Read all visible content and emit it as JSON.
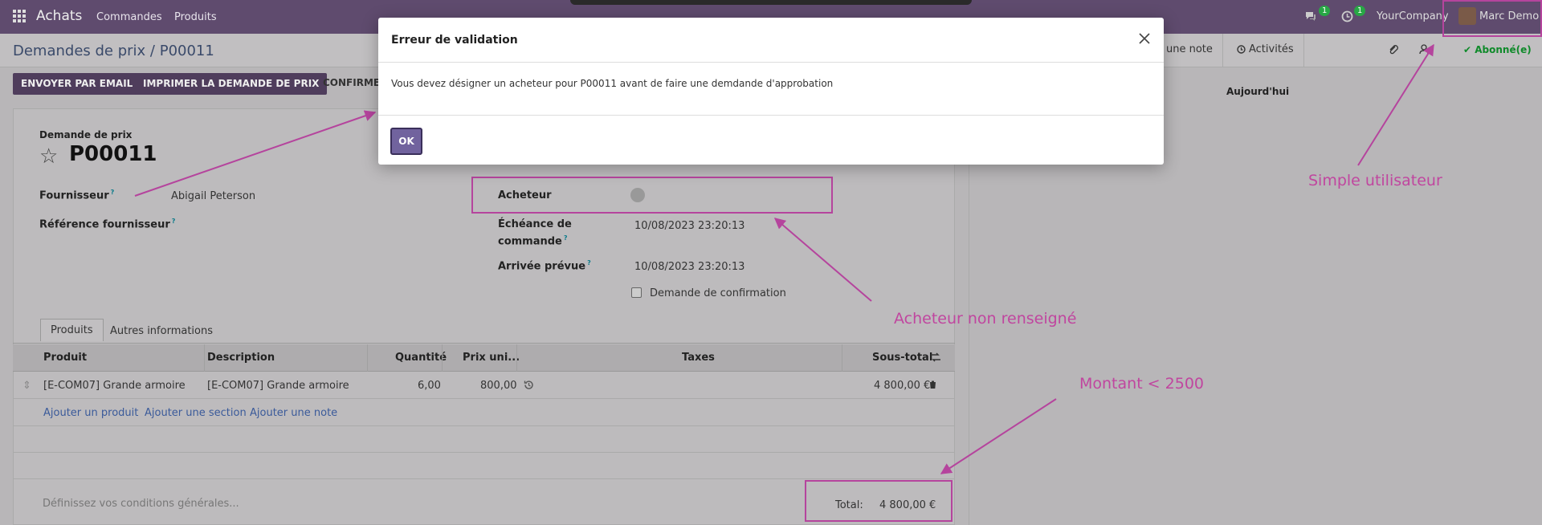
{
  "navbar": {
    "app_name": "Achats",
    "menu": [
      "Commandes",
      "Produits"
    ],
    "messages_count": "1",
    "activities_count": "1",
    "company": "YourCompany",
    "user": "Marc Demo"
  },
  "control_panel": {
    "breadcrumb": "Demandes de prix / P00011",
    "log_note": "une note",
    "activities": "Activités",
    "subscribed": "Abonné(e)"
  },
  "actions": {
    "send_email": "ENVOYER PAR EMAIL",
    "print": "IMPRIMER LA DEMANDE DE PRIX",
    "confirm": "CONFIRME"
  },
  "form": {
    "record_type": "Demande de prix",
    "name": "P00011",
    "supplier_label": "Fournisseur",
    "supplier_value": "Abigail Peterson",
    "supplier_ref_label": "Référence fournisseur",
    "buyer_label": "Acheteur",
    "deadline_label_1": "Échéance de",
    "deadline_label_2": "commande",
    "deadline_value": "10/08/2023 23:20:13",
    "arrival_label": "Arrivée prévue",
    "arrival_value": "10/08/2023 23:20:13",
    "confirm_request_label": "Demande de confirmation",
    "tooltip_mark": "?"
  },
  "tabs": [
    "Produits",
    "Autres informations"
  ],
  "table": {
    "headers": [
      "Produit",
      "Description",
      "Quantité",
      "Prix uni...",
      "Taxes",
      "Sous-total"
    ],
    "row": {
      "product": "[E-COM07] Grande armoire",
      "description": "[E-COM07] Grande armoire",
      "quantity": "6,00",
      "unit_price": "800,00",
      "taxes": "",
      "subtotal": "4 800,00 €"
    },
    "add_links": [
      "Ajouter un produit",
      "Ajouter une section",
      "Ajouter une note"
    ]
  },
  "footer": {
    "terms_placeholder": "Définissez vos conditions générales...",
    "total_label": "Total:",
    "total_value": "4 800,00 €"
  },
  "chatter": {
    "today": "Aujourd'hui"
  },
  "modal": {
    "title": "Erreur de validation",
    "message": "Vous devez désigner un acheteur pour P00011 avant de faire une demdande d'approbation",
    "ok": "OK"
  },
  "annotations": {
    "simple_user": "Simple utilisateur",
    "buyer_missing": "Acheteur non renseigné",
    "amount": "Montant < 2500"
  },
  "colors": {
    "navbar": "#5f4b6e",
    "annotation": "#c0469f",
    "primary_button": "#71639e"
  }
}
